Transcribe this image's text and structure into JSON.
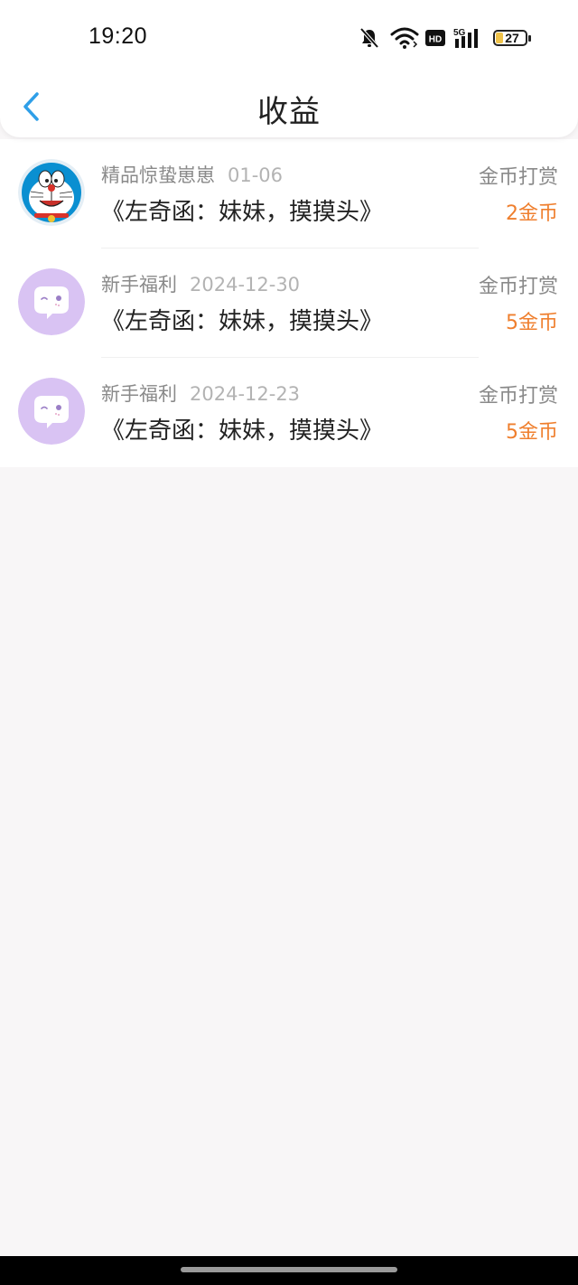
{
  "status_bar": {
    "time": "19:20",
    "battery_level": "27",
    "icons": [
      "bell-off-icon",
      "wifi-icon",
      "hd-icon",
      "signal-5g-icon",
      "battery-icon"
    ]
  },
  "nav": {
    "back_icon": "chevron-left-icon",
    "title": "收益",
    "accent_color": "#2f9fe8"
  },
  "records": [
    {
      "avatar": "doraemon-avatar",
      "source": "精品惊蛰崽崽",
      "date": "01-06",
      "title": "《左奇函：妹妹，摸摸头》",
      "type": "金币打赏",
      "amount": "2金币"
    },
    {
      "avatar": "chat-bubble-avatar",
      "source": "新手福利",
      "date": "2024-12-30",
      "title": "《左奇函：妹妹，摸摸头》",
      "type": "金币打赏",
      "amount": "5金币"
    },
    {
      "avatar": "chat-bubble-avatar",
      "source": "新手福利",
      "date": "2024-12-23",
      "title": "《左奇函：妹妹，摸摸头》",
      "type": "金币打赏",
      "amount": "5金币"
    }
  ],
  "colors": {
    "amount": "#ef7f2e",
    "muted_text": "#8a8a8a",
    "background": "#f8f6f7",
    "avatar_purple": "#d9c3f3"
  }
}
